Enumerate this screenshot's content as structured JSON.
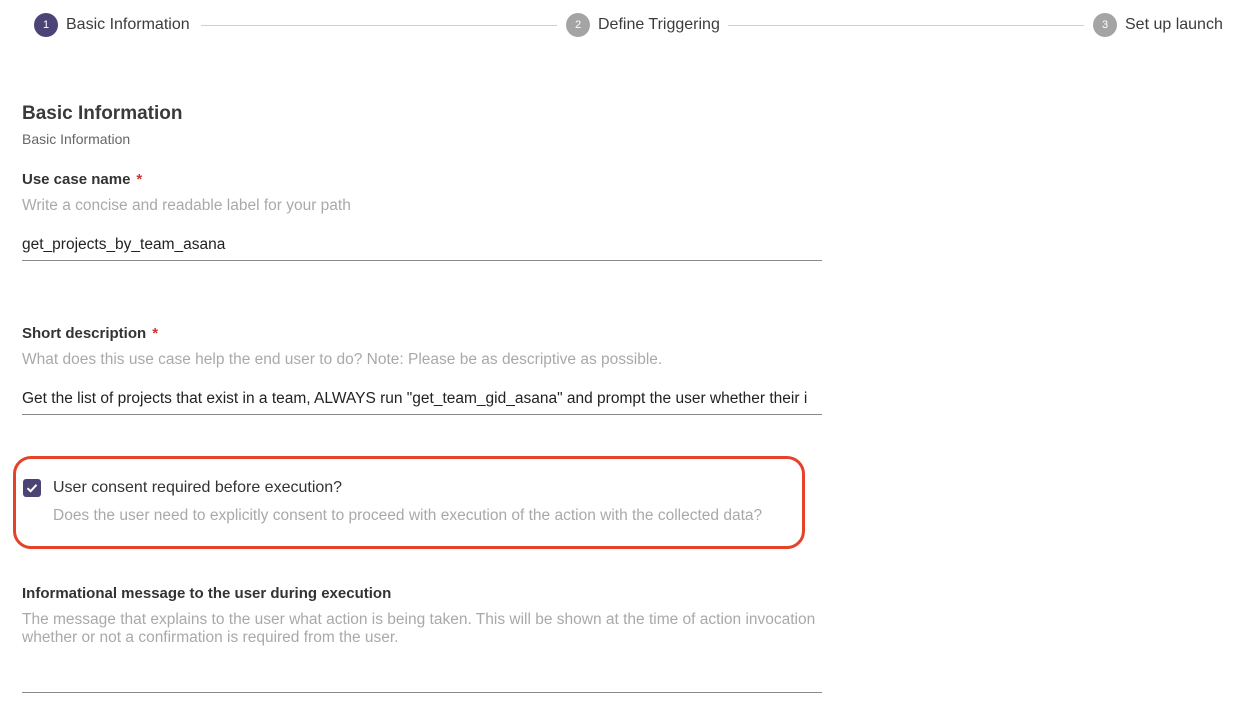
{
  "stepper": {
    "steps": [
      {
        "number": "1",
        "label": "Basic Information",
        "state": "active"
      },
      {
        "number": "2",
        "label": "Define Triggering",
        "state": "inactive"
      },
      {
        "number": "3",
        "label": "Set up launch",
        "state": "inactive"
      }
    ]
  },
  "section": {
    "title": "Basic Information",
    "subtitle": "Basic Information"
  },
  "use_case_name": {
    "label": "Use case name",
    "required_mark": "*",
    "help": "Write a concise and readable label for your path",
    "value": "get_projects_by_team_asana"
  },
  "short_description": {
    "label": "Short description",
    "required_mark": "*",
    "help": "What does this use case help the end user to do? Note: Please be as descriptive as possible.",
    "value": "Get the list of projects that exist in a team, ALWAYS run \"get_team_gid_asana\" and prompt the user whether their i"
  },
  "consent": {
    "label": "User consent required before execution?",
    "help": "Does the user need to explicitly consent to proceed with execution of the action with the collected data?",
    "checked": true
  },
  "info_message": {
    "label": "Informational message to the user during execution",
    "help": "The message that explains to the user what action is being taken. This will be shown at the time of action invocation whether or not a confirmation is required from the user.",
    "value": ""
  },
  "colors": {
    "accent": "#4c4476",
    "highlight": "#e4422a",
    "required": "#c8372d"
  }
}
